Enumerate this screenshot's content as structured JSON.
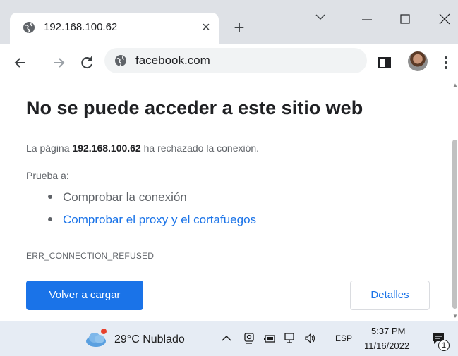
{
  "browser": {
    "tab": {
      "title": "192.168.100.62",
      "close_glyph": "×"
    },
    "new_tab_glyph": "+",
    "window_controls": [
      "chevron-down-icon",
      "minimize-icon",
      "maximize-icon",
      "close-icon"
    ],
    "omnibox": {
      "url": "facebook.com"
    }
  },
  "page": {
    "title": "No se puede acceder a este sitio web",
    "desc_prefix": "La página ",
    "desc_host": "192.168.100.62",
    "desc_suffix": " ha rechazado la conexión.",
    "try_label": "Prueba a:",
    "suggestions": [
      "Comprobar la conexión",
      "Comprobar el proxy y el cortafuegos"
    ],
    "error_code": "ERR_CONNECTION_REFUSED",
    "reload_label": "Volver a cargar",
    "details_label": "Detalles"
  },
  "taskbar": {
    "weather": "29°C  Nublado",
    "language": "ESP",
    "time": "5:37 PM",
    "date": "11/16/2022",
    "notification_count": "1"
  },
  "colors": {
    "accent": "#1a73e8",
    "tabstrip": "#dee1e6",
    "taskbar": "#e6ecf4"
  }
}
